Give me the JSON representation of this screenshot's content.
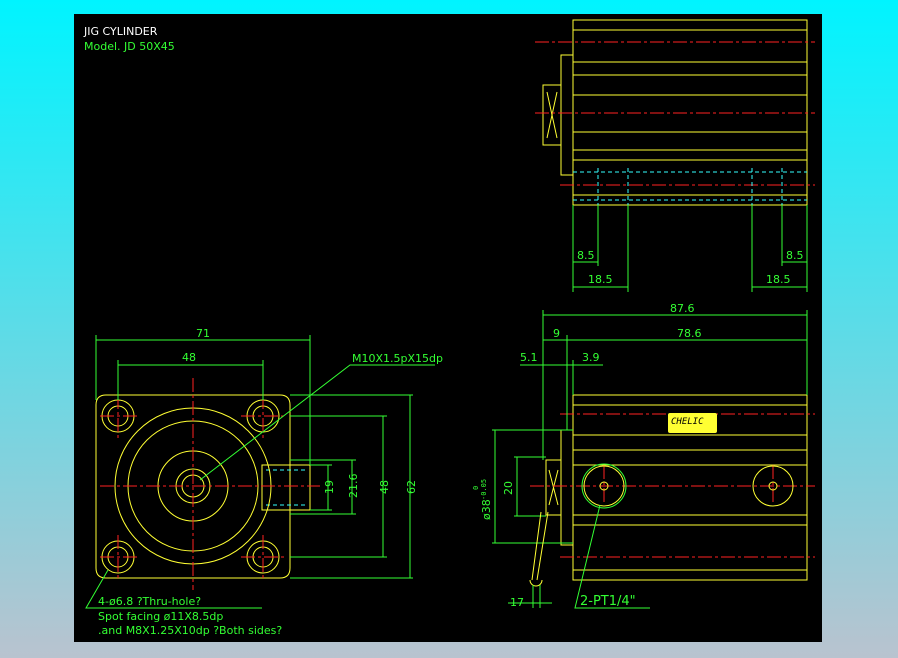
{
  "title": "JIG CYLINDER",
  "model": "Model. JD 50X45",
  "colors": {
    "outline": "#ffff33",
    "dimension": "#33ff33",
    "centerline": "#ff2222",
    "hidden": "#33ffff",
    "background": "#000000"
  },
  "top_view": {
    "dims": [
      "8.5",
      "18.5",
      "8.5",
      "18.5"
    ]
  },
  "side_view": {
    "dims": {
      "overall": "87.6",
      "cap": "9",
      "body": "78.6",
      "left": "5.1",
      "right": "3.9",
      "bore": "ø38",
      "tolerance_upper": "0",
      "tolerance_lower": "-0.05",
      "rod": "20",
      "wrench": "17"
    },
    "port_label": "2-PT1/4\"",
    "brand_label": "CHELIC"
  },
  "front_view": {
    "dims": {
      "width": "71",
      "pitch": "48",
      "h19": "19",
      "h21_6": "21.6",
      "h48": "48",
      "h62": "62"
    },
    "thread_label": "M10X1.5pX15dp",
    "notes": [
      "4-ø6.8   ?Thru-hole?",
      "Spot facing  ø11X8.5dp",
      ".and M8X1.25X10dp ?Both sides?"
    ]
  }
}
